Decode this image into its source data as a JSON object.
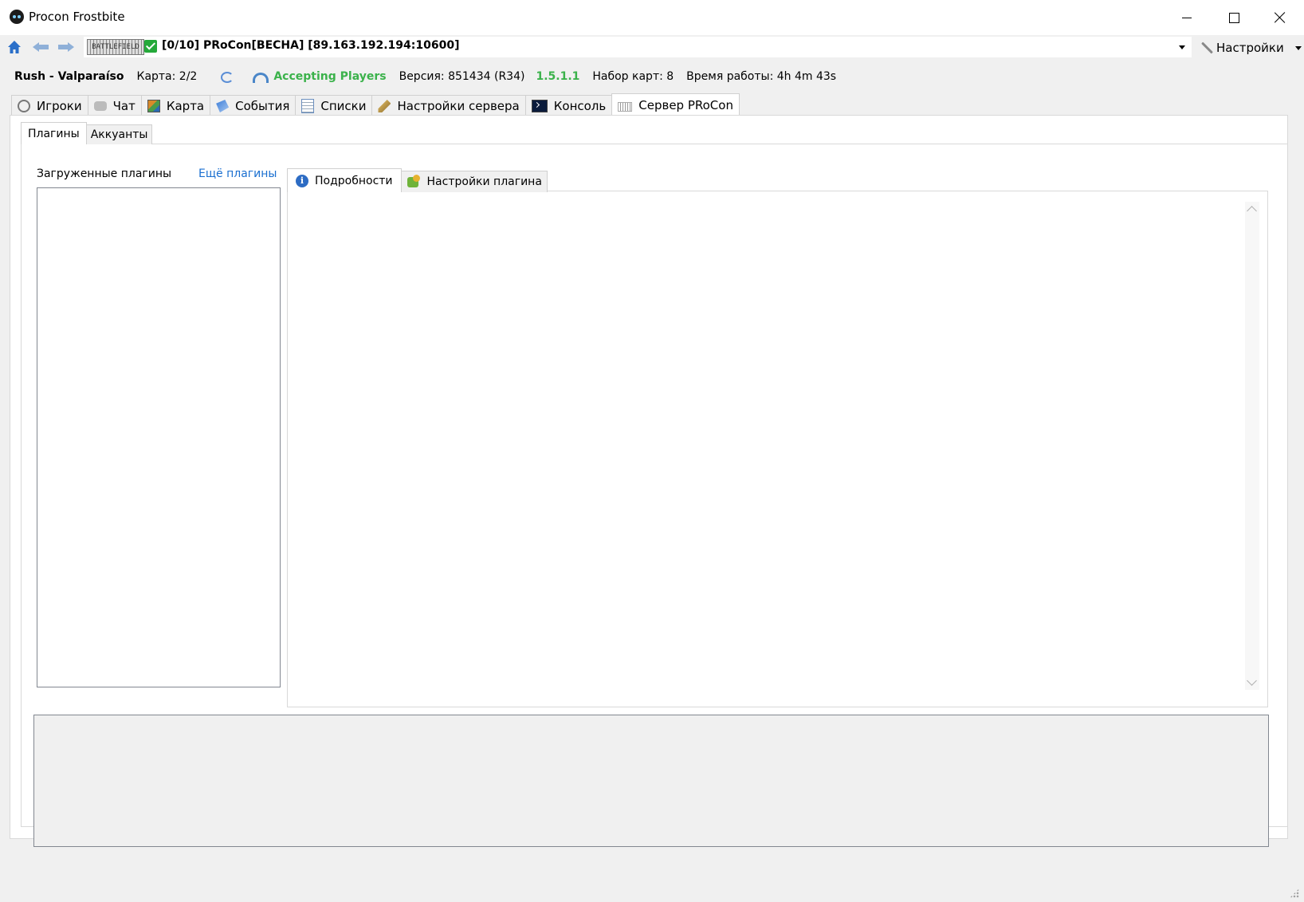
{
  "window": {
    "title": "Procon Frostbite"
  },
  "serverbar": {
    "game_logo": "BATTLEFIELD",
    "server_name": "[0/10] PRoCon[BECHA] [89.163.192.194:10600]",
    "settings_label": "Настройки"
  },
  "info": {
    "map_name": "Rush - Valparaíso",
    "map_count": "Карта: 2/2",
    "status": "Accepting Players",
    "version": "Версия: 851434 (R34)",
    "procon_version": "1.5.1.1",
    "map_set": "Набор карт: 8",
    "uptime": "Время работы: 4h 4m 43s",
    "status_color": "#3bb24b"
  },
  "main_tabs": [
    {
      "label": "Игроки",
      "icon": "players-icon"
    },
    {
      "label": "Чат",
      "icon": "chat-icon"
    },
    {
      "label": "Карта",
      "icon": "map-icon"
    },
    {
      "label": "События",
      "icon": "events-icon"
    },
    {
      "label": "Списки",
      "icon": "lists-icon"
    },
    {
      "label": "Настройки сервера",
      "icon": "server-settings-icon"
    },
    {
      "label": "Консоль",
      "icon": "console-icon"
    },
    {
      "label": "Сервер PRoCon",
      "icon": "procon-server-icon",
      "active": true
    }
  ],
  "sub_tabs": [
    {
      "label": "Плагины",
      "active": true
    },
    {
      "label": "Аккуанты"
    }
  ],
  "plugins": {
    "loaded_label": "Загруженные плагины",
    "more_link": "Ещё плагины",
    "detail_tabs": [
      {
        "label": "Подробности",
        "icon": "info-icon",
        "active": true
      },
      {
        "label": "Настройки плагина",
        "icon": "puzzle-icon"
      }
    ]
  }
}
